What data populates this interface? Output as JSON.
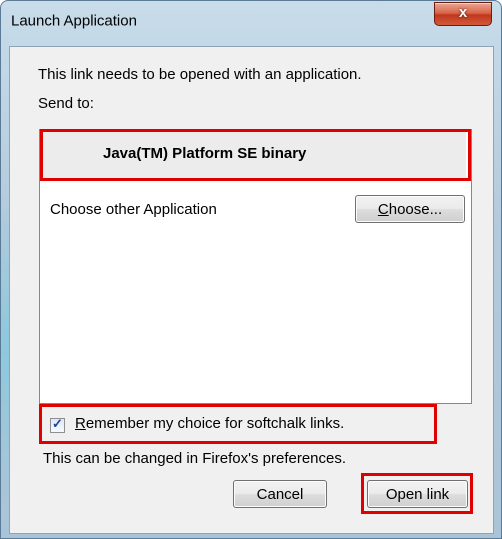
{
  "window": {
    "title": "Launch Application",
    "close_symbol": "x",
    "close_icon": "close-icon"
  },
  "content": {
    "line1": "This link needs to be opened with an application.",
    "line2": "Send to:",
    "app_list": {
      "selected_app": "Java(TM) Platform SE binary",
      "other_app_label": "Choose other Application",
      "choose_button": {
        "mnemonic": "C",
        "rest": "hoose..."
      }
    },
    "remember": {
      "checked": true,
      "check_symbol": "✓",
      "mnemonic": "R",
      "rest": "emember my choice for softchalk links."
    },
    "changed_note": "This can be changed in Firefox's preferences."
  },
  "buttons": {
    "cancel": "Cancel",
    "open": "Open link"
  },
  "colors": {
    "highlight": "#e00000",
    "title_glass": "#b3cbdd",
    "close_button": "#c2371b",
    "dialog_bg": "#f0f0f0"
  }
}
